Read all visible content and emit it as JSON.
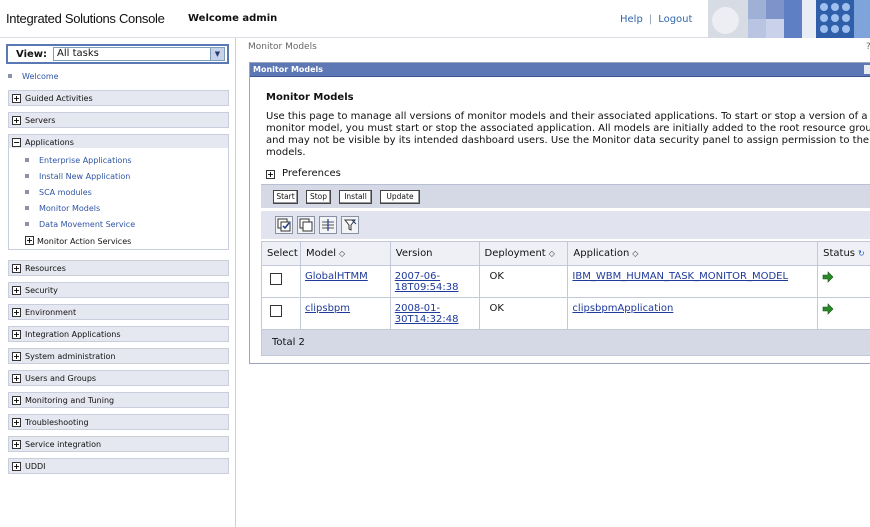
{
  "header": {
    "brand": "Integrated Solutions Console",
    "welcome": "Welcome admin",
    "help": "Help",
    "separator": "|",
    "logout": "Logout"
  },
  "nav": {
    "view_label": "View:",
    "view_value": "All tasks",
    "welcome": "Welcome",
    "applications": {
      "label": "Applications",
      "children": [
        "Enterprise Applications",
        "Install New Application",
        "SCA modules",
        "Monitor Models",
        "Data Movement Service"
      ],
      "expandable_child": "Monitor Action Services"
    },
    "sections_top": [
      "Guided Activities",
      "Servers"
    ],
    "sections_bottom": [
      "Resources",
      "Security",
      "Environment",
      "Integration Applications",
      "System administration",
      "Users and Groups",
      "Monitoring and Tuning",
      "Troubleshooting",
      "Service integration",
      "UDDI"
    ]
  },
  "main": {
    "breadcrumb": "Monitor Models",
    "breadcrumb_right": "?",
    "portlet_title": "Monitor Models",
    "page_title": "Monitor Models",
    "description": "Use this page to manage all versions of monitor models and their associated applications. To start or stop a version of a monitor model, you must start or stop the associated application. All models are initially added to the root resource group and may not be visible by its intended dashboard users. Use the Monitor data security panel to assign permission to the models.",
    "preferences": "Preferences",
    "buttons": [
      "Start",
      "Stop",
      "Install",
      "Update"
    ],
    "table": {
      "headers": [
        "Select",
        "Model",
        "Version",
        "Deployment",
        "Application",
        "Status"
      ],
      "rows": [
        {
          "model": "GlobalHTMM",
          "version_1": "2007-06-",
          "version_2": "18T09:54:38",
          "deployment": "OK",
          "application": "IBM_WBM_HUMAN_TASK_MONITOR_MODEL"
        },
        {
          "model": "clipsbpm",
          "version_1": "2008-01-",
          "version_2": "30T14:32:48",
          "deployment": "OK",
          "application": "clipsbpmApplication"
        }
      ],
      "total": "Total 2"
    }
  },
  "colors": {
    "accent": "#5e78b6",
    "link": "#1e3a9a",
    "nav_bg": "#e5e8f0",
    "status_ok": "#2a8a2a"
  }
}
